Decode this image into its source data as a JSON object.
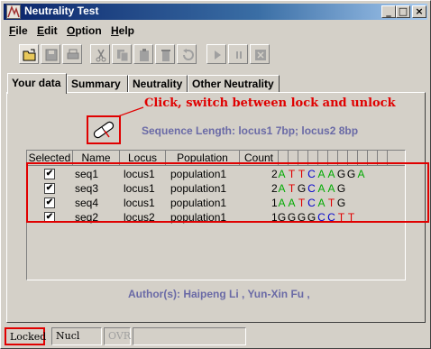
{
  "window": {
    "title": "Neutrality Test",
    "minimize": "_",
    "maximize": "□",
    "close": "×"
  },
  "menu": [
    {
      "label": "File",
      "mnemonic": "F",
      "rest": "ile"
    },
    {
      "label": "Edit",
      "mnemonic": "E",
      "rest": "dit"
    },
    {
      "label": "Option",
      "mnemonic": "O",
      "rest": "ption"
    },
    {
      "label": "Help",
      "mnemonic": "H",
      "rest": "elp"
    }
  ],
  "toolbar": {
    "icons": [
      "open-folder-icon",
      "save-icon",
      "print-icon",
      "cut-icon",
      "copy-icon",
      "paste-icon",
      "delete-icon",
      "undo-icon",
      "play-icon",
      "pause-icon",
      "stop-icon"
    ]
  },
  "tabs": [
    {
      "label": "Your data",
      "selected": true
    },
    {
      "label": "Summary",
      "selected": false
    },
    {
      "label": "Neutrality",
      "selected": false
    },
    {
      "label": "Other Neutrality",
      "selected": false
    }
  ],
  "annotation": "Click, switch between lock and unlock",
  "sequence_length": "Sequence Length:  locus1 7bp; locus2 8bp",
  "table": {
    "headers": [
      "Selected",
      "Name",
      "Locus",
      "Population",
      "Count"
    ],
    "rows": [
      {
        "selected": true,
        "name": "seq1",
        "locus": "locus1",
        "population": "population1",
        "count": "2",
        "seq": [
          "A",
          "T",
          "T",
          "C",
          "A",
          "A",
          "G",
          "G",
          "A"
        ]
      },
      {
        "selected": true,
        "name": "seq3",
        "locus": "locus1",
        "population": "population1",
        "count": "2",
        "seq": [
          "A",
          "T",
          "G",
          "C",
          "A",
          "A",
          "G"
        ]
      },
      {
        "selected": true,
        "name": "seq4",
        "locus": "locus1",
        "population": "population1",
        "count": "1",
        "seq": [
          "A",
          "A",
          "T",
          "C",
          "A",
          "T",
          "G"
        ]
      },
      {
        "selected": true,
        "name": "seq2",
        "locus": "locus2",
        "population": "population1",
        "count": "1",
        "seq": [
          "G",
          "G",
          "G",
          "G",
          "C",
          "C",
          "T",
          "T"
        ]
      }
    ]
  },
  "nucleotide_colors": {
    "A": "#00aa00",
    "T": "#e00000",
    "C": "#0000cc",
    "G": "#000000"
  },
  "authors": "Author(s): Haipeng Li , Yun-Xin Fu ,",
  "status": {
    "lock": "Locked",
    "mode": "Nucl",
    "ovr": "OVR"
  },
  "colors": {
    "highlight": "#e00000",
    "info_text": "#6a6aa6",
    "title_bar": "#0a246a"
  }
}
